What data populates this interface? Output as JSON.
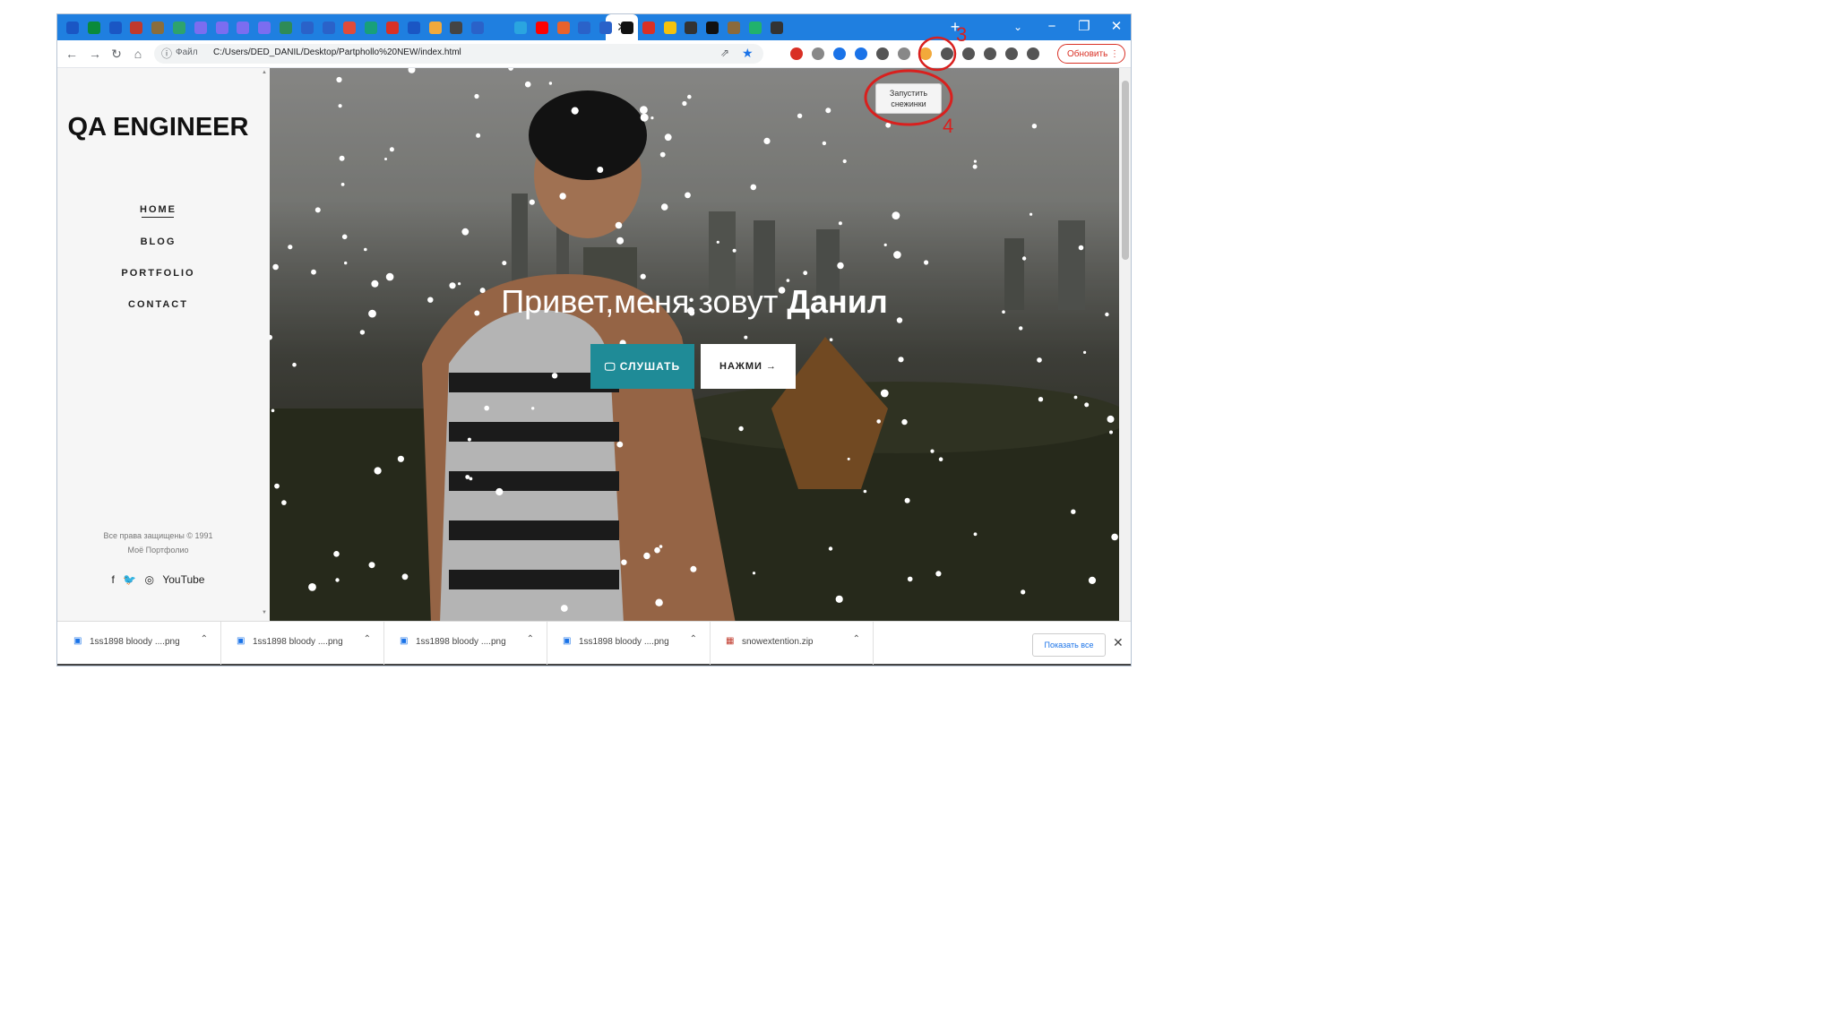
{
  "browser": {
    "active_tab_close": "✕",
    "new_tab": "+",
    "tab_search": "⌄",
    "window_controls": {
      "minimize": "−",
      "restore": "❐",
      "close": "✕"
    },
    "tab_colors": [
      "#1a56c4",
      "#0a8a3a",
      "#1a56c4",
      "#c0392b",
      "#8a6d3b",
      "#2ea36d",
      "#7b6df0",
      "#7b6df0",
      "#7b6df0",
      "#7b6df0",
      "#2e8b57",
      "#2a62c9",
      "#2a62c9",
      "#e04b3a",
      "#18a07a",
      "#d93025",
      "#1a56c4",
      "#f2a93b",
      "#444444",
      "#2a62c9",
      "#2aa5e0",
      "#ff0000",
      "#e8622c",
      "#2a62c9",
      "#2a62c9",
      "#111111",
      "#d93025",
      "#f4c20d",
      "#333333",
      "#111111",
      "#8b6a3b",
      "#21b26c",
      "#333333"
    ]
  },
  "toolbar": {
    "back": "←",
    "forward": "→",
    "reload": "↻",
    "home": "⌂",
    "scheme": "Файл",
    "url": "C:/Users/DED_DANIL/Desktop/Partphollo%20NEW/index.html",
    "share": "⇗",
    "star": "★",
    "extension_colors": [
      "#d93025",
      "#888888",
      "#1a73e8",
      "#1a73e8",
      "#555555",
      "#888888",
      "#f2a93b",
      "#555555",
      "#555555",
      "#555555",
      "#555555",
      "#555555"
    ],
    "update_label": "Обновить"
  },
  "extension_tooltip": {
    "line1": "Запустить",
    "line2": "снежинки"
  },
  "annotations": {
    "marker3": "3",
    "marker4": "4",
    "color": "#d9201e"
  },
  "sidebar": {
    "title": "QA ENGINEER",
    "nav": [
      "HOME",
      "BLOG",
      "PORTFOLIO",
      "CONTACT"
    ],
    "copyright_line1": "Все права защищены © 1991",
    "copyright_line2": "Моё Портфолио",
    "social": [
      "f",
      "🐦",
      "◎",
      "YouTube"
    ]
  },
  "hero": {
    "title_prefix": "Привет,меня зовут ",
    "title_name": "Данил",
    "listen_button": "🖵 СЛУШАТЬ",
    "press_button": "НАЖМИ →"
  },
  "downloads": {
    "items": [
      "1ss1898 bloody ....png",
      "1ss1898 bloody ....png",
      "1ss1898 bloody ....png",
      "1ss1898 bloody ....png",
      "snowextention.zip"
    ],
    "chevron": "⌃",
    "show_all": "Показать все",
    "close": "✕"
  }
}
